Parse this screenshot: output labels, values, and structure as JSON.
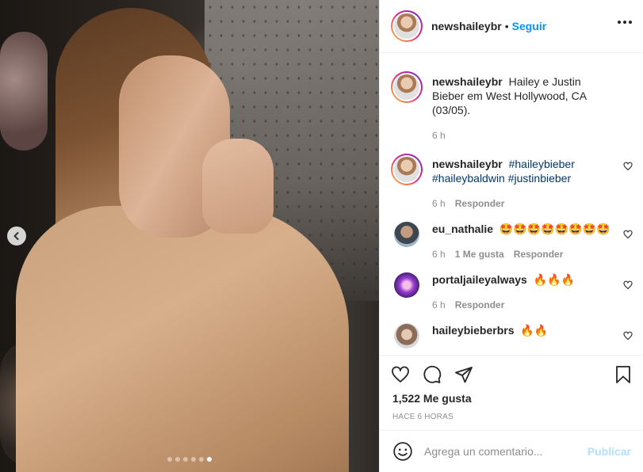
{
  "post": {
    "author": "newshaileybr",
    "follow_label": "Seguir",
    "separator": "•",
    "caption": "Hailey e Justin Bieber em West Hollywood, CA (03/05).",
    "caption_time": "6 h",
    "carousel": {
      "dots": 6,
      "active_dot": 6
    }
  },
  "comments": [
    {
      "username": "newshaileybr",
      "text": "",
      "hashtags": [
        "#haileybieber",
        "#haileybaldwin",
        "#justinbieber"
      ],
      "time": "6 h",
      "likes": "",
      "reply": "Responder"
    },
    {
      "username": "eu_nathalie",
      "text": "🤩🤩🤩🤩🤩🤩🤩🤩",
      "time": "6 h",
      "likes": "1 Me gusta",
      "reply": "Responder"
    },
    {
      "username": "portaljaileyalways",
      "text": "🔥🔥🔥",
      "time": "6 h",
      "likes": "",
      "reply": "Responder"
    },
    {
      "username": "haileybieberbrs",
      "text": "🔥🔥",
      "time": "",
      "likes": "",
      "reply": ""
    }
  ],
  "actions": {
    "likes_count": "1,522 Me gusta",
    "posted_ago": "HACE 6 HORAS"
  },
  "add_comment": {
    "placeholder": "Agrega un comentario...",
    "publish_label": "Publicar"
  },
  "colors": {
    "link_blue": "#0095f6",
    "hashtag": "#00376b",
    "muted": "#8e8e8e",
    "publish_disabled": "#b2dffc"
  }
}
